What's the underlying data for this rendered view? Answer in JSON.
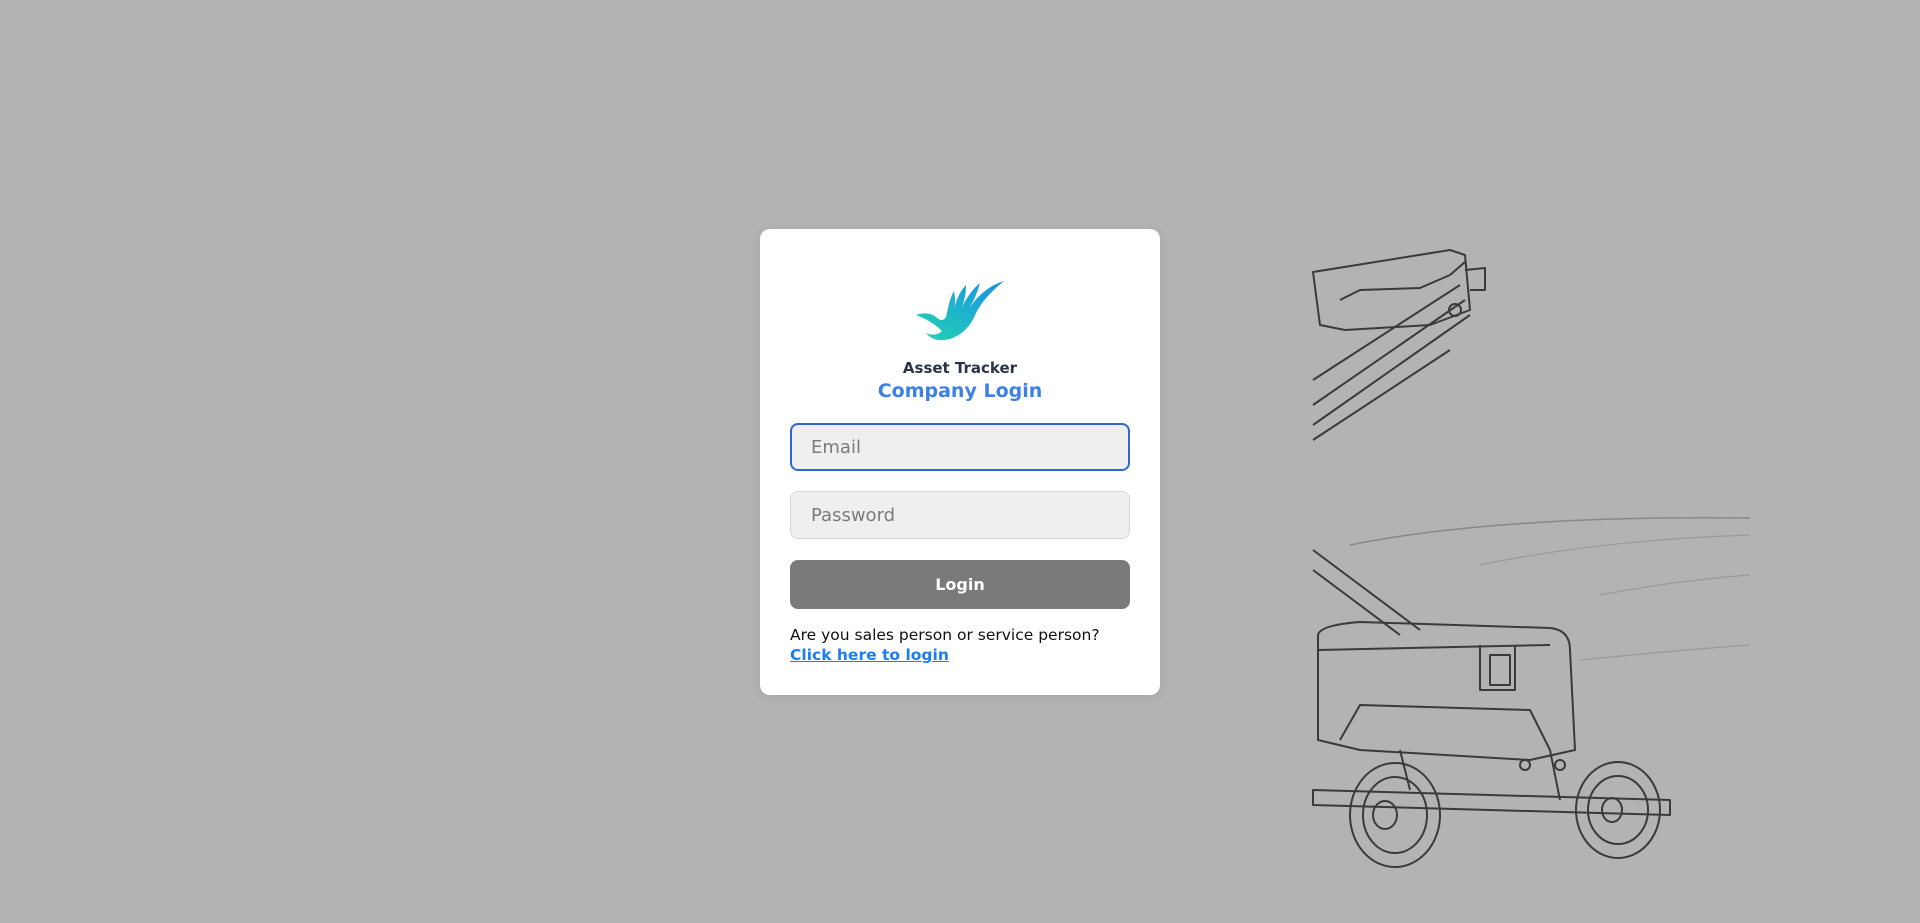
{
  "brand": {
    "app_name": "Asset Tracker",
    "logo_icon": "bird-wing-logo-icon",
    "accent_color": "#3c82e6"
  },
  "login_form": {
    "title": "Company Login",
    "email_placeholder": "Email",
    "password_placeholder": "Password",
    "login_label": "Login",
    "alt_prompt": "Are you sales person or service person?",
    "alt_link_label": " Click here to login"
  },
  "background": {
    "illustration_icon": "boom-lift-sketch-icon"
  }
}
